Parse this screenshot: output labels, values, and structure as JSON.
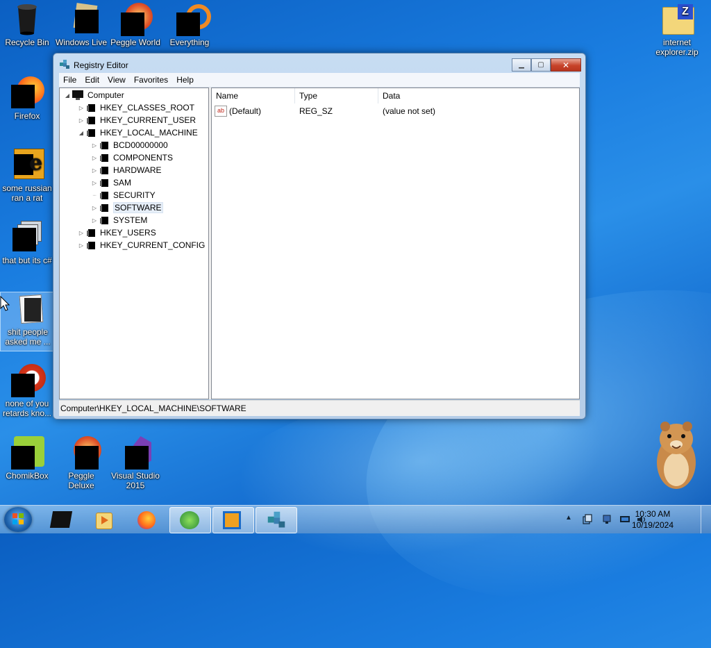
{
  "desktop": {
    "icons": [
      {
        "label": "Recycle Bin"
      },
      {
        "label": "Windows Live"
      },
      {
        "label": "Peggle World"
      },
      {
        "label": "Everything"
      },
      {
        "label": "Firefox"
      },
      {
        "label": "some russian ran a rat"
      },
      {
        "label": "that but its c#"
      },
      {
        "label": "shit people asked me ..."
      },
      {
        "label": "none of you retards kno..."
      },
      {
        "label": "ChomikBox"
      },
      {
        "label": "Peggle Deluxe"
      },
      {
        "label": "Visual Studio 2015"
      },
      {
        "label": "internet explorer.zip"
      }
    ]
  },
  "window": {
    "title": "Registry Editor",
    "menu": [
      "File",
      "Edit",
      "View",
      "Favorites",
      "Help"
    ],
    "tree": [
      {
        "label": "Computer"
      },
      {
        "label": "HKEY_CLASSES_ROOT"
      },
      {
        "label": "HKEY_CURRENT_USER"
      },
      {
        "label": "HKEY_LOCAL_MACHINE"
      },
      {
        "label": "BCD00000000"
      },
      {
        "label": "COMPONENTS"
      },
      {
        "label": "HARDWARE"
      },
      {
        "label": "SAM"
      },
      {
        "label": "SECURITY"
      },
      {
        "label": "SOFTWARE"
      },
      {
        "label": "SYSTEM"
      },
      {
        "label": "HKEY_USERS"
      },
      {
        "label": "HKEY_CURRENT_CONFIG"
      }
    ],
    "columns": [
      "Name",
      "Type",
      "Data"
    ],
    "rows": [
      {
        "name": "(Default)",
        "type": "REG_SZ",
        "data": "(value not set)"
      }
    ],
    "status_path": "Computer\\HKEY_LOCAL_MACHINE\\SOFTWARE"
  },
  "taskbar": {
    "time": "10:30 AM",
    "date": "10/19/2024"
  }
}
